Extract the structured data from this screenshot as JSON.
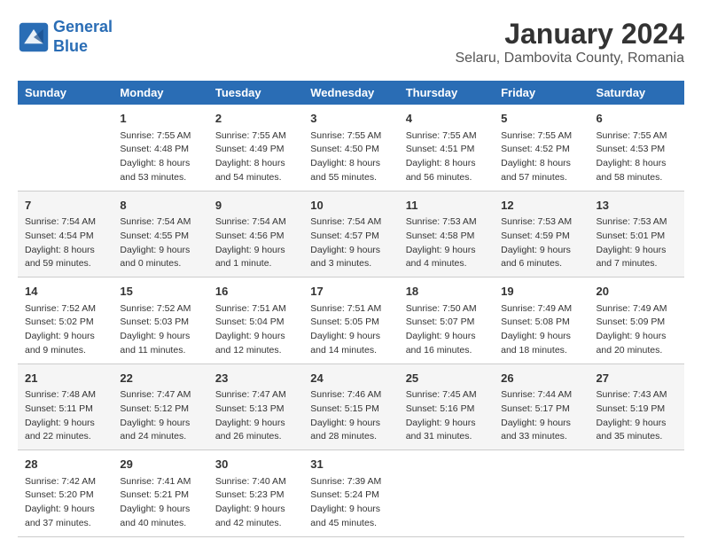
{
  "logo": {
    "line1": "General",
    "line2": "Blue"
  },
  "title": "January 2024",
  "subtitle": "Selaru, Dambovita County, Romania",
  "days_header": [
    "Sunday",
    "Monday",
    "Tuesday",
    "Wednesday",
    "Thursday",
    "Friday",
    "Saturday"
  ],
  "weeks": [
    [
      {
        "day": "",
        "info": ""
      },
      {
        "day": "1",
        "info": "Sunrise: 7:55 AM\nSunset: 4:48 PM\nDaylight: 8 hours\nand 53 minutes."
      },
      {
        "day": "2",
        "info": "Sunrise: 7:55 AM\nSunset: 4:49 PM\nDaylight: 8 hours\nand 54 minutes."
      },
      {
        "day": "3",
        "info": "Sunrise: 7:55 AM\nSunset: 4:50 PM\nDaylight: 8 hours\nand 55 minutes."
      },
      {
        "day": "4",
        "info": "Sunrise: 7:55 AM\nSunset: 4:51 PM\nDaylight: 8 hours\nand 56 minutes."
      },
      {
        "day": "5",
        "info": "Sunrise: 7:55 AM\nSunset: 4:52 PM\nDaylight: 8 hours\nand 57 minutes."
      },
      {
        "day": "6",
        "info": "Sunrise: 7:55 AM\nSunset: 4:53 PM\nDaylight: 8 hours\nand 58 minutes."
      }
    ],
    [
      {
        "day": "7",
        "info": "Sunrise: 7:54 AM\nSunset: 4:54 PM\nDaylight: 8 hours\nand 59 minutes."
      },
      {
        "day": "8",
        "info": "Sunrise: 7:54 AM\nSunset: 4:55 PM\nDaylight: 9 hours\nand 0 minutes."
      },
      {
        "day": "9",
        "info": "Sunrise: 7:54 AM\nSunset: 4:56 PM\nDaylight: 9 hours\nand 1 minute."
      },
      {
        "day": "10",
        "info": "Sunrise: 7:54 AM\nSunset: 4:57 PM\nDaylight: 9 hours\nand 3 minutes."
      },
      {
        "day": "11",
        "info": "Sunrise: 7:53 AM\nSunset: 4:58 PM\nDaylight: 9 hours\nand 4 minutes."
      },
      {
        "day": "12",
        "info": "Sunrise: 7:53 AM\nSunset: 4:59 PM\nDaylight: 9 hours\nand 6 minutes."
      },
      {
        "day": "13",
        "info": "Sunrise: 7:53 AM\nSunset: 5:01 PM\nDaylight: 9 hours\nand 7 minutes."
      }
    ],
    [
      {
        "day": "14",
        "info": "Sunrise: 7:52 AM\nSunset: 5:02 PM\nDaylight: 9 hours\nand 9 minutes."
      },
      {
        "day": "15",
        "info": "Sunrise: 7:52 AM\nSunset: 5:03 PM\nDaylight: 9 hours\nand 11 minutes."
      },
      {
        "day": "16",
        "info": "Sunrise: 7:51 AM\nSunset: 5:04 PM\nDaylight: 9 hours\nand 12 minutes."
      },
      {
        "day": "17",
        "info": "Sunrise: 7:51 AM\nSunset: 5:05 PM\nDaylight: 9 hours\nand 14 minutes."
      },
      {
        "day": "18",
        "info": "Sunrise: 7:50 AM\nSunset: 5:07 PM\nDaylight: 9 hours\nand 16 minutes."
      },
      {
        "day": "19",
        "info": "Sunrise: 7:49 AM\nSunset: 5:08 PM\nDaylight: 9 hours\nand 18 minutes."
      },
      {
        "day": "20",
        "info": "Sunrise: 7:49 AM\nSunset: 5:09 PM\nDaylight: 9 hours\nand 20 minutes."
      }
    ],
    [
      {
        "day": "21",
        "info": "Sunrise: 7:48 AM\nSunset: 5:11 PM\nDaylight: 9 hours\nand 22 minutes."
      },
      {
        "day": "22",
        "info": "Sunrise: 7:47 AM\nSunset: 5:12 PM\nDaylight: 9 hours\nand 24 minutes."
      },
      {
        "day": "23",
        "info": "Sunrise: 7:47 AM\nSunset: 5:13 PM\nDaylight: 9 hours\nand 26 minutes."
      },
      {
        "day": "24",
        "info": "Sunrise: 7:46 AM\nSunset: 5:15 PM\nDaylight: 9 hours\nand 28 minutes."
      },
      {
        "day": "25",
        "info": "Sunrise: 7:45 AM\nSunset: 5:16 PM\nDaylight: 9 hours\nand 31 minutes."
      },
      {
        "day": "26",
        "info": "Sunrise: 7:44 AM\nSunset: 5:17 PM\nDaylight: 9 hours\nand 33 minutes."
      },
      {
        "day": "27",
        "info": "Sunrise: 7:43 AM\nSunset: 5:19 PM\nDaylight: 9 hours\nand 35 minutes."
      }
    ],
    [
      {
        "day": "28",
        "info": "Sunrise: 7:42 AM\nSunset: 5:20 PM\nDaylight: 9 hours\nand 37 minutes."
      },
      {
        "day": "29",
        "info": "Sunrise: 7:41 AM\nSunset: 5:21 PM\nDaylight: 9 hours\nand 40 minutes."
      },
      {
        "day": "30",
        "info": "Sunrise: 7:40 AM\nSunset: 5:23 PM\nDaylight: 9 hours\nand 42 minutes."
      },
      {
        "day": "31",
        "info": "Sunrise: 7:39 AM\nSunset: 5:24 PM\nDaylight: 9 hours\nand 45 minutes."
      },
      {
        "day": "",
        "info": ""
      },
      {
        "day": "",
        "info": ""
      },
      {
        "day": "",
        "info": ""
      }
    ]
  ]
}
